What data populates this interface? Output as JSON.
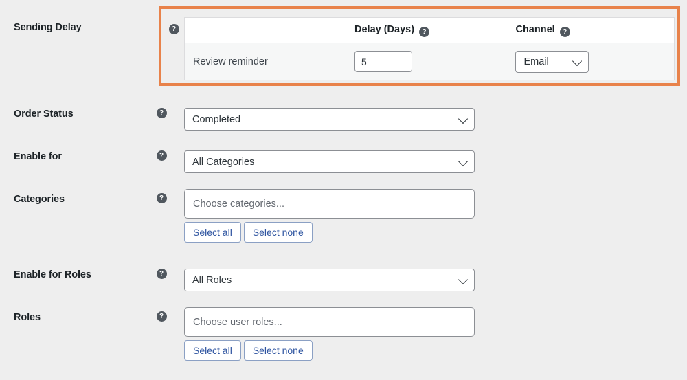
{
  "theme": {
    "page_background": "#eeeeee",
    "highlight_border": "#e8824a",
    "table_header_bg": "#ffffff",
    "table_row_bg": "#f6f7f7",
    "link_button_text": "#2e54a0",
    "help_icon_bg": "#50575e"
  },
  "icons": {
    "help": "?",
    "help_name": "help-icon",
    "chevron": "chevron-down-icon"
  },
  "rows": {
    "sending_delay": {
      "label": "Sending Delay",
      "table": {
        "headers": [
          "",
          "Delay (Days)",
          "Channel"
        ],
        "header_name": "",
        "header_delay": "Delay (Days)",
        "header_channel": "Channel",
        "rows": [
          {
            "name": "Review reminder",
            "delay_value": "5",
            "channel_value": "Email"
          }
        ]
      }
    },
    "order_status": {
      "label": "Order Status",
      "value": "Completed"
    },
    "enable_for": {
      "label": "Enable for",
      "value": "All Categories"
    },
    "categories": {
      "label": "Categories",
      "placeholder": "Choose categories...",
      "select_all": "Select all",
      "select_none": "Select none"
    },
    "enable_for_roles": {
      "label": "Enable for Roles",
      "value": "All Roles"
    },
    "roles": {
      "label": "Roles",
      "placeholder": "Choose user roles...",
      "select_all": "Select all",
      "select_none": "Select none"
    }
  }
}
